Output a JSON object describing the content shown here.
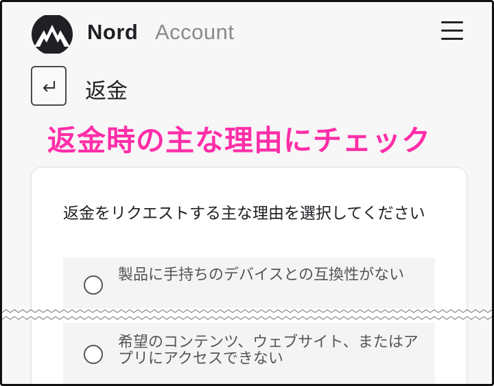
{
  "header": {
    "brand_primary": "Nord",
    "brand_secondary": "Account",
    "logo_icon": "nord-mountain-logo",
    "menu_icon": "hamburger-menu-icon"
  },
  "page": {
    "back_icon": "return-arrow-icon",
    "title": "返金"
  },
  "annotation": {
    "text": "返金時の主な理由にチェック",
    "color": "#ff2ea8"
  },
  "form": {
    "question": "返金をリクエストする主な理由を選択してください",
    "options": [
      {
        "label": "製品に手持ちのデバイスとの互換性がない",
        "selected": false
      },
      {
        "label": "希望のコンテンツ、ウェブサイト、またはアプリにアクセスできない",
        "selected": false
      }
    ]
  }
}
